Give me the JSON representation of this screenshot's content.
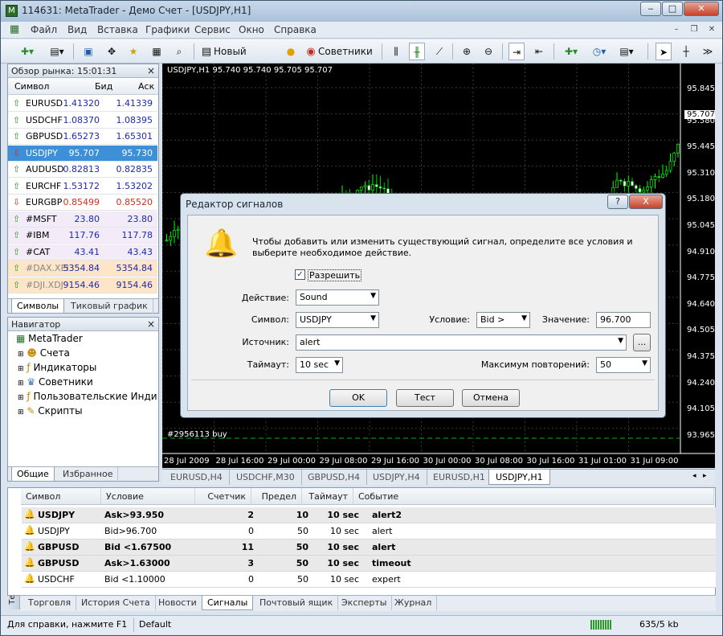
{
  "window": {
    "title": "114631: MetaTrader - Демо Счет - [USDJPY,H1]"
  },
  "menu": [
    "Файл",
    "Вид",
    "Вставка",
    "Графики",
    "Сервис",
    "Окно",
    "Справка"
  ],
  "toolbar": {
    "new_order": "Новый Ордер",
    "experts": "Советники"
  },
  "market_watch": {
    "title": "Обзор рынка: 15:01:31",
    "headers": {
      "symbol": "Символ",
      "bid": "Бид",
      "ask": "Аск"
    },
    "rows": [
      {
        "symbol": "EURUSD",
        "bid": "1.41320",
        "ask": "1.41339",
        "dir": "up"
      },
      {
        "symbol": "USDCHF",
        "bid": "1.08370",
        "ask": "1.08395",
        "dir": "up"
      },
      {
        "symbol": "GBPUSD",
        "bid": "1.65273",
        "ask": "1.65301",
        "dir": "up"
      },
      {
        "symbol": "USDJPY",
        "bid": "95.707",
        "ask": "95.730",
        "dir": "down"
      },
      {
        "symbol": "AUDUSD",
        "bid": "0.82813",
        "ask": "0.82835",
        "dir": "up"
      },
      {
        "symbol": "EURCHF",
        "bid": "1.53172",
        "ask": "1.53202",
        "dir": "up"
      },
      {
        "symbol": "EURGBP",
        "bid": "0.85499",
        "ask": "0.85520",
        "dir": "down"
      },
      {
        "symbol": "#MSFT",
        "bid": "23.80",
        "ask": "23.80",
        "dir": "up"
      },
      {
        "symbol": "#IBM",
        "bid": "117.76",
        "ask": "117.78",
        "dir": "up"
      },
      {
        "symbol": "#CAT",
        "bid": "43.41",
        "ask": "43.43",
        "dir": "up"
      },
      {
        "symbol": "#DAX.XEI",
        "bid": "5354.84",
        "ask": "5354.84",
        "dir": "up"
      },
      {
        "symbol": "#DJI.XDJ",
        "bid": "9154.46",
        "ask": "9154.46",
        "dir": "up"
      }
    ],
    "tabs": [
      "Символы",
      "Тиковый график"
    ]
  },
  "navigator": {
    "title": "Навигатор",
    "root": "MetaTrader",
    "items": [
      "Счета",
      "Индикаторы",
      "Советники",
      "Пользовательские Инди",
      "Скрипты"
    ],
    "tabs": [
      "Общие",
      "Избранное"
    ]
  },
  "chart": {
    "header": "USDJPY,H1  95.740 95.740 95.705 95.707",
    "current_price": "95.707",
    "price_labels": [
      "95.845",
      "95.707",
      "95.580",
      "95.445",
      "95.310",
      "95.180",
      "95.045",
      "94.910",
      "94.775",
      "94.640",
      "94.505",
      "94.375",
      "94.240",
      "94.105",
      "93.965"
    ],
    "time_labels": [
      "28 Jul 2009",
      "28 Jul 16:00",
      "29 Jul 00:00",
      "29 Jul 08:00",
      "29 Jul 16:00",
      "30 Jul 00:00",
      "30 Jul 08:00",
      "30 Jul 16:00",
      "31 Jul 01:00",
      "31 Jul 09:00"
    ],
    "order_label": "#2956113 buy",
    "tabs": [
      "EURUSD,H4",
      "USDCHF,M30",
      "GBPUSD,H4",
      "USDJPY,H4",
      "EURUSD,H1",
      "USDJPY,H1"
    ]
  },
  "dialog": {
    "title": "Редактор сигналов",
    "help_btn": "?",
    "close_btn": "X",
    "description": "Чтобы добавить или изменить существующий сигнал, определите все условия и выберите необходимое действие.",
    "enable_label": "Разрешить",
    "action_label": "Действие:",
    "action_value": "Sound",
    "symbol_label": "Символ:",
    "symbol_value": "USDJPY",
    "condition_label": "Условие:",
    "condition_value": "Bid >",
    "value_label": "Значение:",
    "value_value": "96.700",
    "source_label": "Источник:",
    "source_value": "alert",
    "browse_btn": "...",
    "timeout_label": "Таймаут:",
    "timeout_value": "10 sec",
    "max_repeat_label": "Максимум повторений:",
    "max_repeat_value": "50",
    "ok_btn": "OK",
    "test_btn": "Тест",
    "cancel_btn": "Отмена"
  },
  "terminal": {
    "side_label": "Терминал",
    "headers": [
      "Символ",
      "Условие",
      "Счетчик",
      "Предел",
      "Таймаут",
      "Событие"
    ],
    "rows": [
      {
        "symbol": "USDJPY",
        "condition": "Ask>93.950",
        "counter": "2",
        "limit": "10",
        "timeout": "10 sec",
        "event": "alert2",
        "bold": true
      },
      {
        "symbol": "USDJPY",
        "condition": "Bid>96.700",
        "counter": "0",
        "limit": "50",
        "timeout": "10 sec",
        "event": "alert",
        "bold": false
      },
      {
        "symbol": "GBPUSD",
        "condition": "Bid <1.67500",
        "counter": "11",
        "limit": "50",
        "timeout": "10 sec",
        "event": "alert",
        "bold": true
      },
      {
        "symbol": "GBPUSD",
        "condition": "Ask>1.63000",
        "counter": "3",
        "limit": "50",
        "timeout": "10 sec",
        "event": "timeout",
        "bold": true
      },
      {
        "symbol": "USDCHF",
        "condition": "Bid <1.10000",
        "counter": "0",
        "limit": "50",
        "timeout": "10 sec",
        "event": "expert",
        "bold": false
      }
    ],
    "tabs": [
      "Торговля",
      "История Счета",
      "Новости",
      "Сигналы",
      "Почтовый ящик",
      "Эксперты",
      "Журнал"
    ]
  },
  "status": {
    "help": "Для справки, нажмите F1",
    "profile": "Default",
    "traffic": "635/5 kb"
  }
}
